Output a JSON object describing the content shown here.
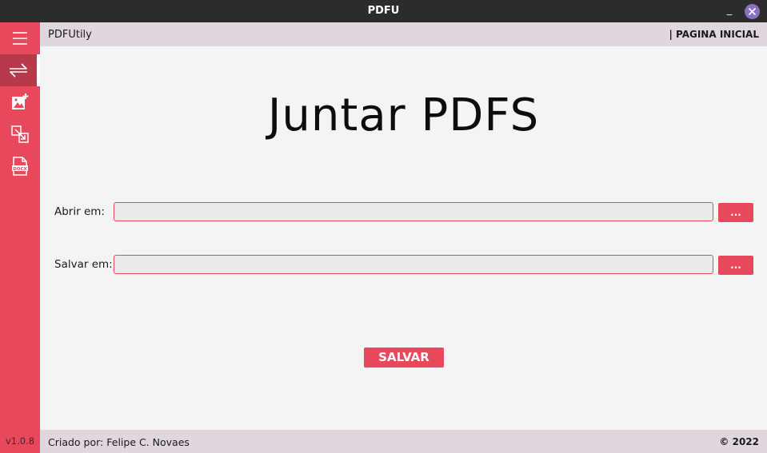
{
  "window": {
    "title": "PDFU",
    "minimize_label": "_"
  },
  "topbar": {
    "app_name": "PDFUtily",
    "page_name": "| PAGINA INICIAL"
  },
  "sidebar": {
    "items": [
      {
        "icon": "menu-icon"
      },
      {
        "icon": "swap-arrows-icon",
        "active": true
      },
      {
        "icon": "add-image-icon"
      },
      {
        "icon": "resize-icon"
      },
      {
        "icon": "docx-file-icon"
      }
    ],
    "version": "v1.0.8"
  },
  "main": {
    "heading": "Juntar PDFS",
    "open_label": "Abrir em:",
    "open_value": "",
    "open_button": "...",
    "save_label": "Salvar em:",
    "save_value": "",
    "save_button_dots": "...",
    "save_button": "SALVAR"
  },
  "footer": {
    "credit": "Criado por: Felipe C. Novaes",
    "copyright": "© 2022"
  },
  "colors": {
    "accent": "#e8485b",
    "titlebar": "#2c2c2c",
    "bar": "#e0d6dd",
    "background": "#f5f4f5",
    "close": "#8a6fbf"
  }
}
